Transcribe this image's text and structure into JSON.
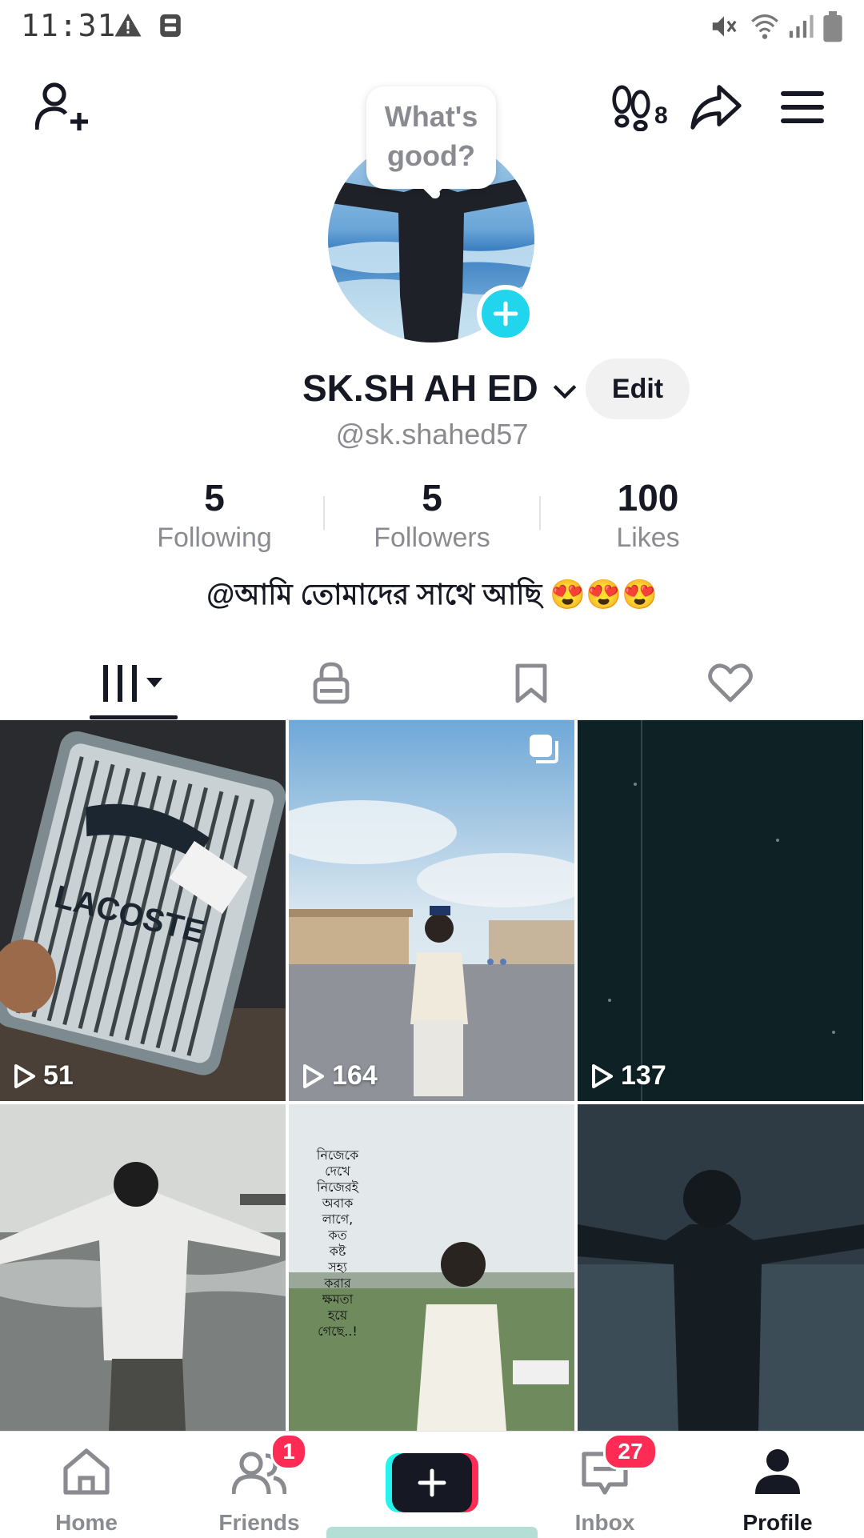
{
  "status_bar": {
    "time": "11:31"
  },
  "top_bar": {
    "footprint_count": "8"
  },
  "profile": {
    "bubble_text_line1": "What's",
    "bubble_text_line2": "good?",
    "display_name": "SK.SH AH ED",
    "edit_label": "Edit",
    "handle": "@sk.shahed57",
    "bio": "@আমি তোমাদের সাথে আছি 😍😍😍"
  },
  "stats": [
    {
      "value": "5",
      "label": "Following"
    },
    {
      "value": "5",
      "label": "Followers"
    },
    {
      "value": "100",
      "label": "Likes"
    }
  ],
  "tabs": [
    {
      "icon": "grid-icon"
    },
    {
      "icon": "lock-icon"
    },
    {
      "icon": "bookmark-icon"
    },
    {
      "icon": "heart-icon"
    }
  ],
  "videos": [
    {
      "views": "51"
    },
    {
      "views": "164"
    },
    {
      "views": "137"
    },
    {
      "views": ""
    },
    {
      "views": ""
    },
    {
      "views": ""
    }
  ],
  "video_overlay_text": [
    "নিজেকে",
    "দেখে",
    "নিজেরই",
    "অবাক",
    "লাগে,",
    "কত",
    "কষ্ট",
    "সহ্য",
    "করার",
    "ক্ষমতা",
    "হয়ে",
    "গেছে..!"
  ],
  "bottom_nav": {
    "home": "Home",
    "friends": "Friends",
    "friends_badge": "1",
    "inbox": "Inbox",
    "inbox_badge": "27",
    "profile": "Profile"
  },
  "colors": {
    "accent_cyan": "#20d5ec",
    "accent_red": "#fe2c55",
    "text_primary": "#161823",
    "text_secondary": "#8a8b91"
  }
}
